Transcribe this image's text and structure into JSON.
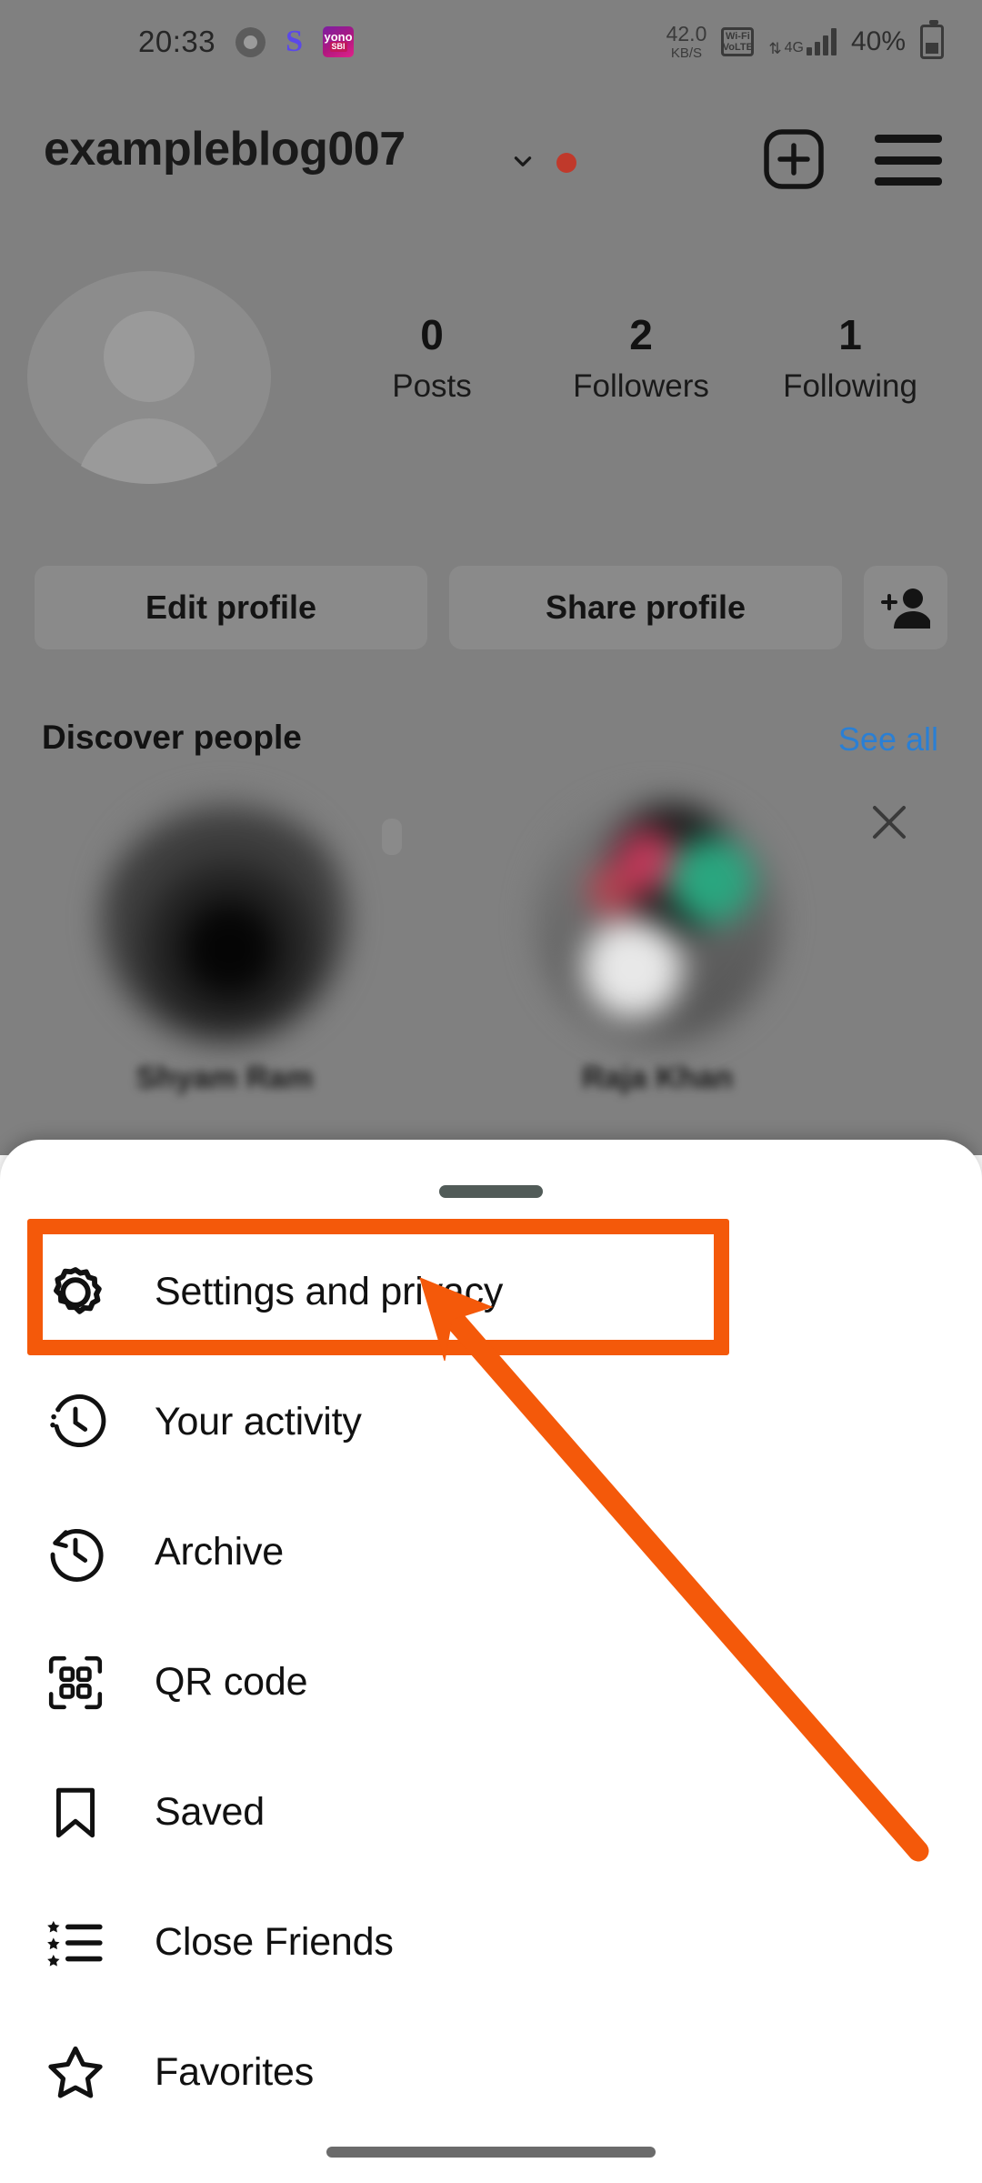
{
  "status_bar": {
    "time": "20:33",
    "icons": [
      "chrome-icon",
      "skype-icon",
      "yono-sbi-icon"
    ],
    "yono_top": "yono",
    "yono_bottom": "SBI",
    "network_speed_value": "42.0",
    "network_speed_unit": "KB/S",
    "volte_top": "Wi-Fi",
    "volte_bottom": "VoLTE",
    "network_type": "4G",
    "battery_percent": "40%"
  },
  "header": {
    "username": "exampleblog007",
    "chevron_icon": "chevron-down-icon",
    "unread_badge": true,
    "create_icon": "plus-square-icon",
    "menu_icon": "hamburger-menu-icon"
  },
  "profile": {
    "avatar_icon": "default-avatar-icon",
    "stats": [
      {
        "count": "0",
        "label": "Posts"
      },
      {
        "count": "2",
        "label": "Followers"
      },
      {
        "count": "1",
        "label": "Following"
      }
    ],
    "buttons": {
      "edit_profile": "Edit profile",
      "share_profile": "Share profile",
      "add_person_icon": "add-person-icon"
    }
  },
  "discover": {
    "title": "Discover people",
    "see_all": "See all",
    "close_icon": "close-icon",
    "cards": [
      {
        "name": "Shyam Ram"
      },
      {
        "name": "Raja Khan"
      }
    ]
  },
  "sheet": {
    "grabber": "drag-handle",
    "items": [
      {
        "label": "Settings and privacy",
        "icon": "gear-icon",
        "highlighted": true
      },
      {
        "label": "Your activity",
        "icon": "activity-clock-icon",
        "highlighted": false
      },
      {
        "label": "Archive",
        "icon": "archive-clock-icon",
        "highlighted": false
      },
      {
        "label": "QR code",
        "icon": "qr-code-icon",
        "highlighted": false
      },
      {
        "label": "Saved",
        "icon": "bookmark-icon",
        "highlighted": false
      },
      {
        "label": "Close Friends",
        "icon": "star-list-icon",
        "highlighted": false
      },
      {
        "label": "Favorites",
        "icon": "star-icon",
        "highlighted": false
      }
    ]
  },
  "annotation": {
    "highlight_color": "#F4590A",
    "arrow_icon": "pointer-arrow-icon",
    "target_label": "Settings and privacy"
  },
  "system": {
    "home_indicator": "home-gesture-bar"
  }
}
